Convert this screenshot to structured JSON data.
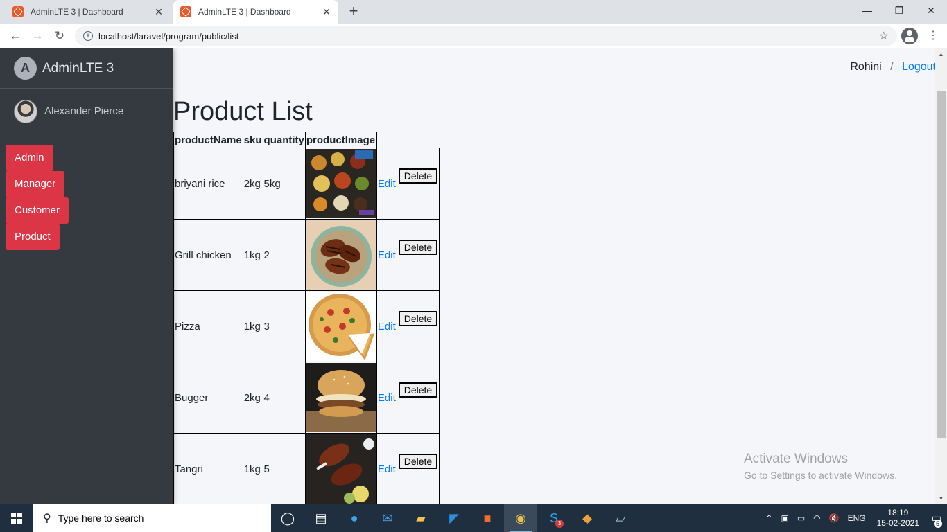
{
  "browser": {
    "tabs": [
      {
        "title": "AdminLTE 3 | Dashboard",
        "active": false
      },
      {
        "title": "AdminLTE 3 | Dashboard",
        "active": true
      }
    ],
    "url": "localhost/laravel/program/public/list"
  },
  "sidebar": {
    "brand": "AdminLTE 3",
    "user_name": "Alexander Pierce",
    "accent_color": "#dc3545",
    "items": [
      {
        "label": "Admin"
      },
      {
        "label": "Manager"
      },
      {
        "label": "Customer"
      },
      {
        "label": "Product"
      }
    ]
  },
  "topnav": {
    "user": "Rohini",
    "separator": "/",
    "logout": "Logout"
  },
  "main": {
    "title": "Product List",
    "columns": [
      "productName",
      "sku",
      "quantity",
      "productImage"
    ],
    "rows": [
      {
        "productName": "briyani rice",
        "sku": "2kg",
        "quantity": "5kg",
        "image": "spices",
        "edit": "Edit",
        "delete": "Delete"
      },
      {
        "productName": "Grill chicken",
        "sku": "1kg",
        "quantity": "2",
        "image": "grill-chicken",
        "edit": "Edit",
        "delete": "Delete"
      },
      {
        "productName": "Pizza",
        "sku": "1kg",
        "quantity": "3",
        "image": "pizza",
        "edit": "Edit",
        "delete": "Delete"
      },
      {
        "productName": "Bugger",
        "sku": "2kg",
        "quantity": "4",
        "image": "burger",
        "edit": "Edit",
        "delete": "Delete"
      },
      {
        "productName": "Tangri",
        "sku": "1kg",
        "quantity": "5",
        "image": "tangri",
        "edit": "Edit",
        "delete": "Delete"
      }
    ]
  },
  "watermark": {
    "line1": "Activate Windows",
    "line2": "Go to Settings to activate Windows."
  },
  "taskbar": {
    "search_placeholder": "Type here to search",
    "language": "ENG",
    "time": "18:19",
    "date": "15-02-2021",
    "notification_count": "5",
    "skype_badge": "3"
  }
}
